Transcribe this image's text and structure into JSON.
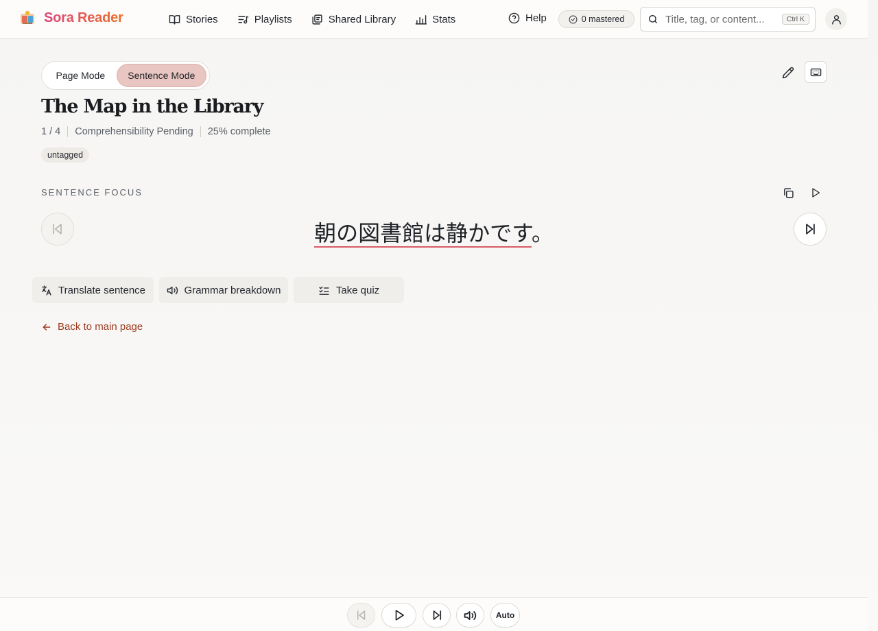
{
  "app": {
    "title": "Sora Reader"
  },
  "nav": {
    "items": [
      {
        "label": "Stories",
        "icon": "book-open-icon"
      },
      {
        "label": "Playlists",
        "icon": "list-music-icon"
      },
      {
        "label": "Shared Library",
        "icon": "library-icon"
      },
      {
        "label": "Stats",
        "icon": "chart-icon"
      }
    ],
    "help": "Help",
    "mastered": "0 mastered",
    "search": {
      "placeholder": "Title, tag, or content...",
      "shortcut": "Ctrl K"
    }
  },
  "modes": {
    "page": "Page Mode",
    "sentence": "Sentence Mode",
    "active": "sentence"
  },
  "story": {
    "title": "The Map in the Library",
    "position": "1 / 4",
    "comprehensibility": "Comprehensibility Pending",
    "progress": "25% complete",
    "tag": "untagged"
  },
  "focus": {
    "label": "SENTENCE FOCUS",
    "sentence_word": "朝の図書館は静かです",
    "sentence_punct": "。"
  },
  "actions": {
    "translate": "Translate sentence",
    "grammar": "Grammar breakdown",
    "quiz": "Take quiz"
  },
  "back": "Back to main page",
  "player": {
    "auto": "Auto"
  },
  "colors": {
    "accent": "#e9c6c1",
    "link": "#9c3a1e",
    "underline": "#d85a66"
  }
}
